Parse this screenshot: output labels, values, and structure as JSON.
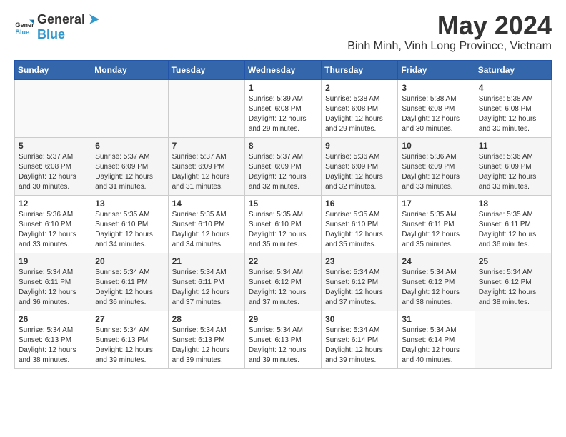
{
  "header": {
    "logo_general": "General",
    "logo_blue": "Blue",
    "month_title": "May 2024",
    "location": "Binh Minh, Vinh Long Province, Vietnam"
  },
  "days_of_week": [
    "Sunday",
    "Monday",
    "Tuesday",
    "Wednesday",
    "Thursday",
    "Friday",
    "Saturday"
  ],
  "weeks": [
    [
      {
        "day": "",
        "info": ""
      },
      {
        "day": "",
        "info": ""
      },
      {
        "day": "",
        "info": ""
      },
      {
        "day": "1",
        "info": "Sunrise: 5:39 AM\nSunset: 6:08 PM\nDaylight: 12 hours\nand 29 minutes."
      },
      {
        "day": "2",
        "info": "Sunrise: 5:38 AM\nSunset: 6:08 PM\nDaylight: 12 hours\nand 29 minutes."
      },
      {
        "day": "3",
        "info": "Sunrise: 5:38 AM\nSunset: 6:08 PM\nDaylight: 12 hours\nand 30 minutes."
      },
      {
        "day": "4",
        "info": "Sunrise: 5:38 AM\nSunset: 6:08 PM\nDaylight: 12 hours\nand 30 minutes."
      }
    ],
    [
      {
        "day": "5",
        "info": "Sunrise: 5:37 AM\nSunset: 6:08 PM\nDaylight: 12 hours\nand 30 minutes."
      },
      {
        "day": "6",
        "info": "Sunrise: 5:37 AM\nSunset: 6:09 PM\nDaylight: 12 hours\nand 31 minutes."
      },
      {
        "day": "7",
        "info": "Sunrise: 5:37 AM\nSunset: 6:09 PM\nDaylight: 12 hours\nand 31 minutes."
      },
      {
        "day": "8",
        "info": "Sunrise: 5:37 AM\nSunset: 6:09 PM\nDaylight: 12 hours\nand 32 minutes."
      },
      {
        "day": "9",
        "info": "Sunrise: 5:36 AM\nSunset: 6:09 PM\nDaylight: 12 hours\nand 32 minutes."
      },
      {
        "day": "10",
        "info": "Sunrise: 5:36 AM\nSunset: 6:09 PM\nDaylight: 12 hours\nand 33 minutes."
      },
      {
        "day": "11",
        "info": "Sunrise: 5:36 AM\nSunset: 6:09 PM\nDaylight: 12 hours\nand 33 minutes."
      }
    ],
    [
      {
        "day": "12",
        "info": "Sunrise: 5:36 AM\nSunset: 6:10 PM\nDaylight: 12 hours\nand 33 minutes."
      },
      {
        "day": "13",
        "info": "Sunrise: 5:35 AM\nSunset: 6:10 PM\nDaylight: 12 hours\nand 34 minutes."
      },
      {
        "day": "14",
        "info": "Sunrise: 5:35 AM\nSunset: 6:10 PM\nDaylight: 12 hours\nand 34 minutes."
      },
      {
        "day": "15",
        "info": "Sunrise: 5:35 AM\nSunset: 6:10 PM\nDaylight: 12 hours\nand 35 minutes."
      },
      {
        "day": "16",
        "info": "Sunrise: 5:35 AM\nSunset: 6:10 PM\nDaylight: 12 hours\nand 35 minutes."
      },
      {
        "day": "17",
        "info": "Sunrise: 5:35 AM\nSunset: 6:11 PM\nDaylight: 12 hours\nand 35 minutes."
      },
      {
        "day": "18",
        "info": "Sunrise: 5:35 AM\nSunset: 6:11 PM\nDaylight: 12 hours\nand 36 minutes."
      }
    ],
    [
      {
        "day": "19",
        "info": "Sunrise: 5:34 AM\nSunset: 6:11 PM\nDaylight: 12 hours\nand 36 minutes."
      },
      {
        "day": "20",
        "info": "Sunrise: 5:34 AM\nSunset: 6:11 PM\nDaylight: 12 hours\nand 36 minutes."
      },
      {
        "day": "21",
        "info": "Sunrise: 5:34 AM\nSunset: 6:11 PM\nDaylight: 12 hours\nand 37 minutes."
      },
      {
        "day": "22",
        "info": "Sunrise: 5:34 AM\nSunset: 6:12 PM\nDaylight: 12 hours\nand 37 minutes."
      },
      {
        "day": "23",
        "info": "Sunrise: 5:34 AM\nSunset: 6:12 PM\nDaylight: 12 hours\nand 37 minutes."
      },
      {
        "day": "24",
        "info": "Sunrise: 5:34 AM\nSunset: 6:12 PM\nDaylight: 12 hours\nand 38 minutes."
      },
      {
        "day": "25",
        "info": "Sunrise: 5:34 AM\nSunset: 6:12 PM\nDaylight: 12 hours\nand 38 minutes."
      }
    ],
    [
      {
        "day": "26",
        "info": "Sunrise: 5:34 AM\nSunset: 6:13 PM\nDaylight: 12 hours\nand 38 minutes."
      },
      {
        "day": "27",
        "info": "Sunrise: 5:34 AM\nSunset: 6:13 PM\nDaylight: 12 hours\nand 39 minutes."
      },
      {
        "day": "28",
        "info": "Sunrise: 5:34 AM\nSunset: 6:13 PM\nDaylight: 12 hours\nand 39 minutes."
      },
      {
        "day": "29",
        "info": "Sunrise: 5:34 AM\nSunset: 6:13 PM\nDaylight: 12 hours\nand 39 minutes."
      },
      {
        "day": "30",
        "info": "Sunrise: 5:34 AM\nSunset: 6:14 PM\nDaylight: 12 hours\nand 39 minutes."
      },
      {
        "day": "31",
        "info": "Sunrise: 5:34 AM\nSunset: 6:14 PM\nDaylight: 12 hours\nand 40 minutes."
      },
      {
        "day": "",
        "info": ""
      }
    ]
  ]
}
